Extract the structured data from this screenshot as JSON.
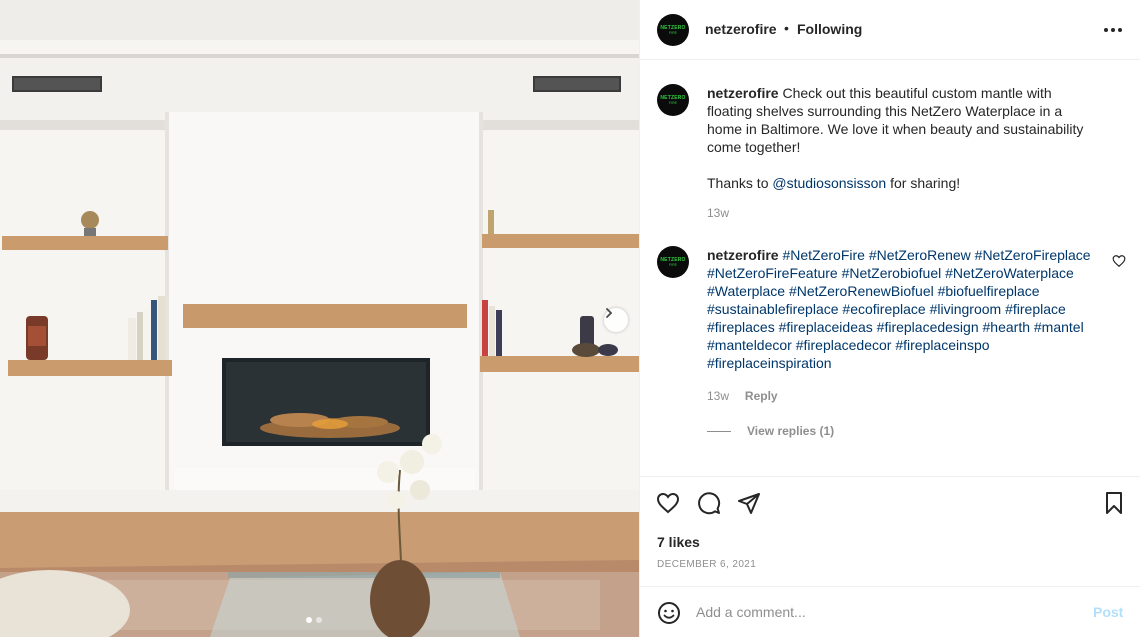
{
  "post": {
    "username": "netzerofire",
    "follow_state": "Following",
    "separator": "•",
    "avatar_text_top": "NETZERO",
    "avatar_text_bottom": "FIRE"
  },
  "caption": {
    "username": "netzerofire",
    "text": "Check out this beautiful custom mantle with floating shelves surrounding this NetZero Waterplace in a home in Baltimore. We love it when beauty and sustainability come together!",
    "thanks_prefix": "Thanks to",
    "mention": "@studiosonsisson",
    "thanks_suffix": "for sharing!",
    "time": "13w"
  },
  "hashtag_comment": {
    "username": "netzerofire",
    "hashtags": [
      "#NetZeroFire",
      "#NetZeroRenew",
      "#NetZeroFireplace",
      "#NetZeroFireFeature",
      "#NetZerobiofuel",
      "#NetZeroWaterplace",
      "#Waterplace",
      "#NetZeroRenewBiofuel",
      "#biofuelfireplace",
      "#sustainablefireplace",
      "#ecofireplace",
      "#livingroom",
      "#fireplace",
      "#fireplaces",
      "#fireplaceideas",
      "#fireplacedesign",
      "#hearth",
      "#mantel",
      "#manteldecor",
      "#fireplacedecor",
      "#fireplaceinspo",
      "#fireplaceinspiration"
    ],
    "time": "13w",
    "reply_label": "Reply",
    "view_replies": "View replies (1)"
  },
  "stats": {
    "likes": "7 likes",
    "date": "December 6, 2021"
  },
  "composer": {
    "placeholder": "Add a comment...",
    "post_label": "Post"
  },
  "carousel": {
    "total": 2,
    "current": 1
  },
  "colors": {
    "link": "#00376b",
    "muted": "#8e8e8e",
    "post_disabled": "#b2dffc",
    "brand_green": "#2ecc40"
  }
}
